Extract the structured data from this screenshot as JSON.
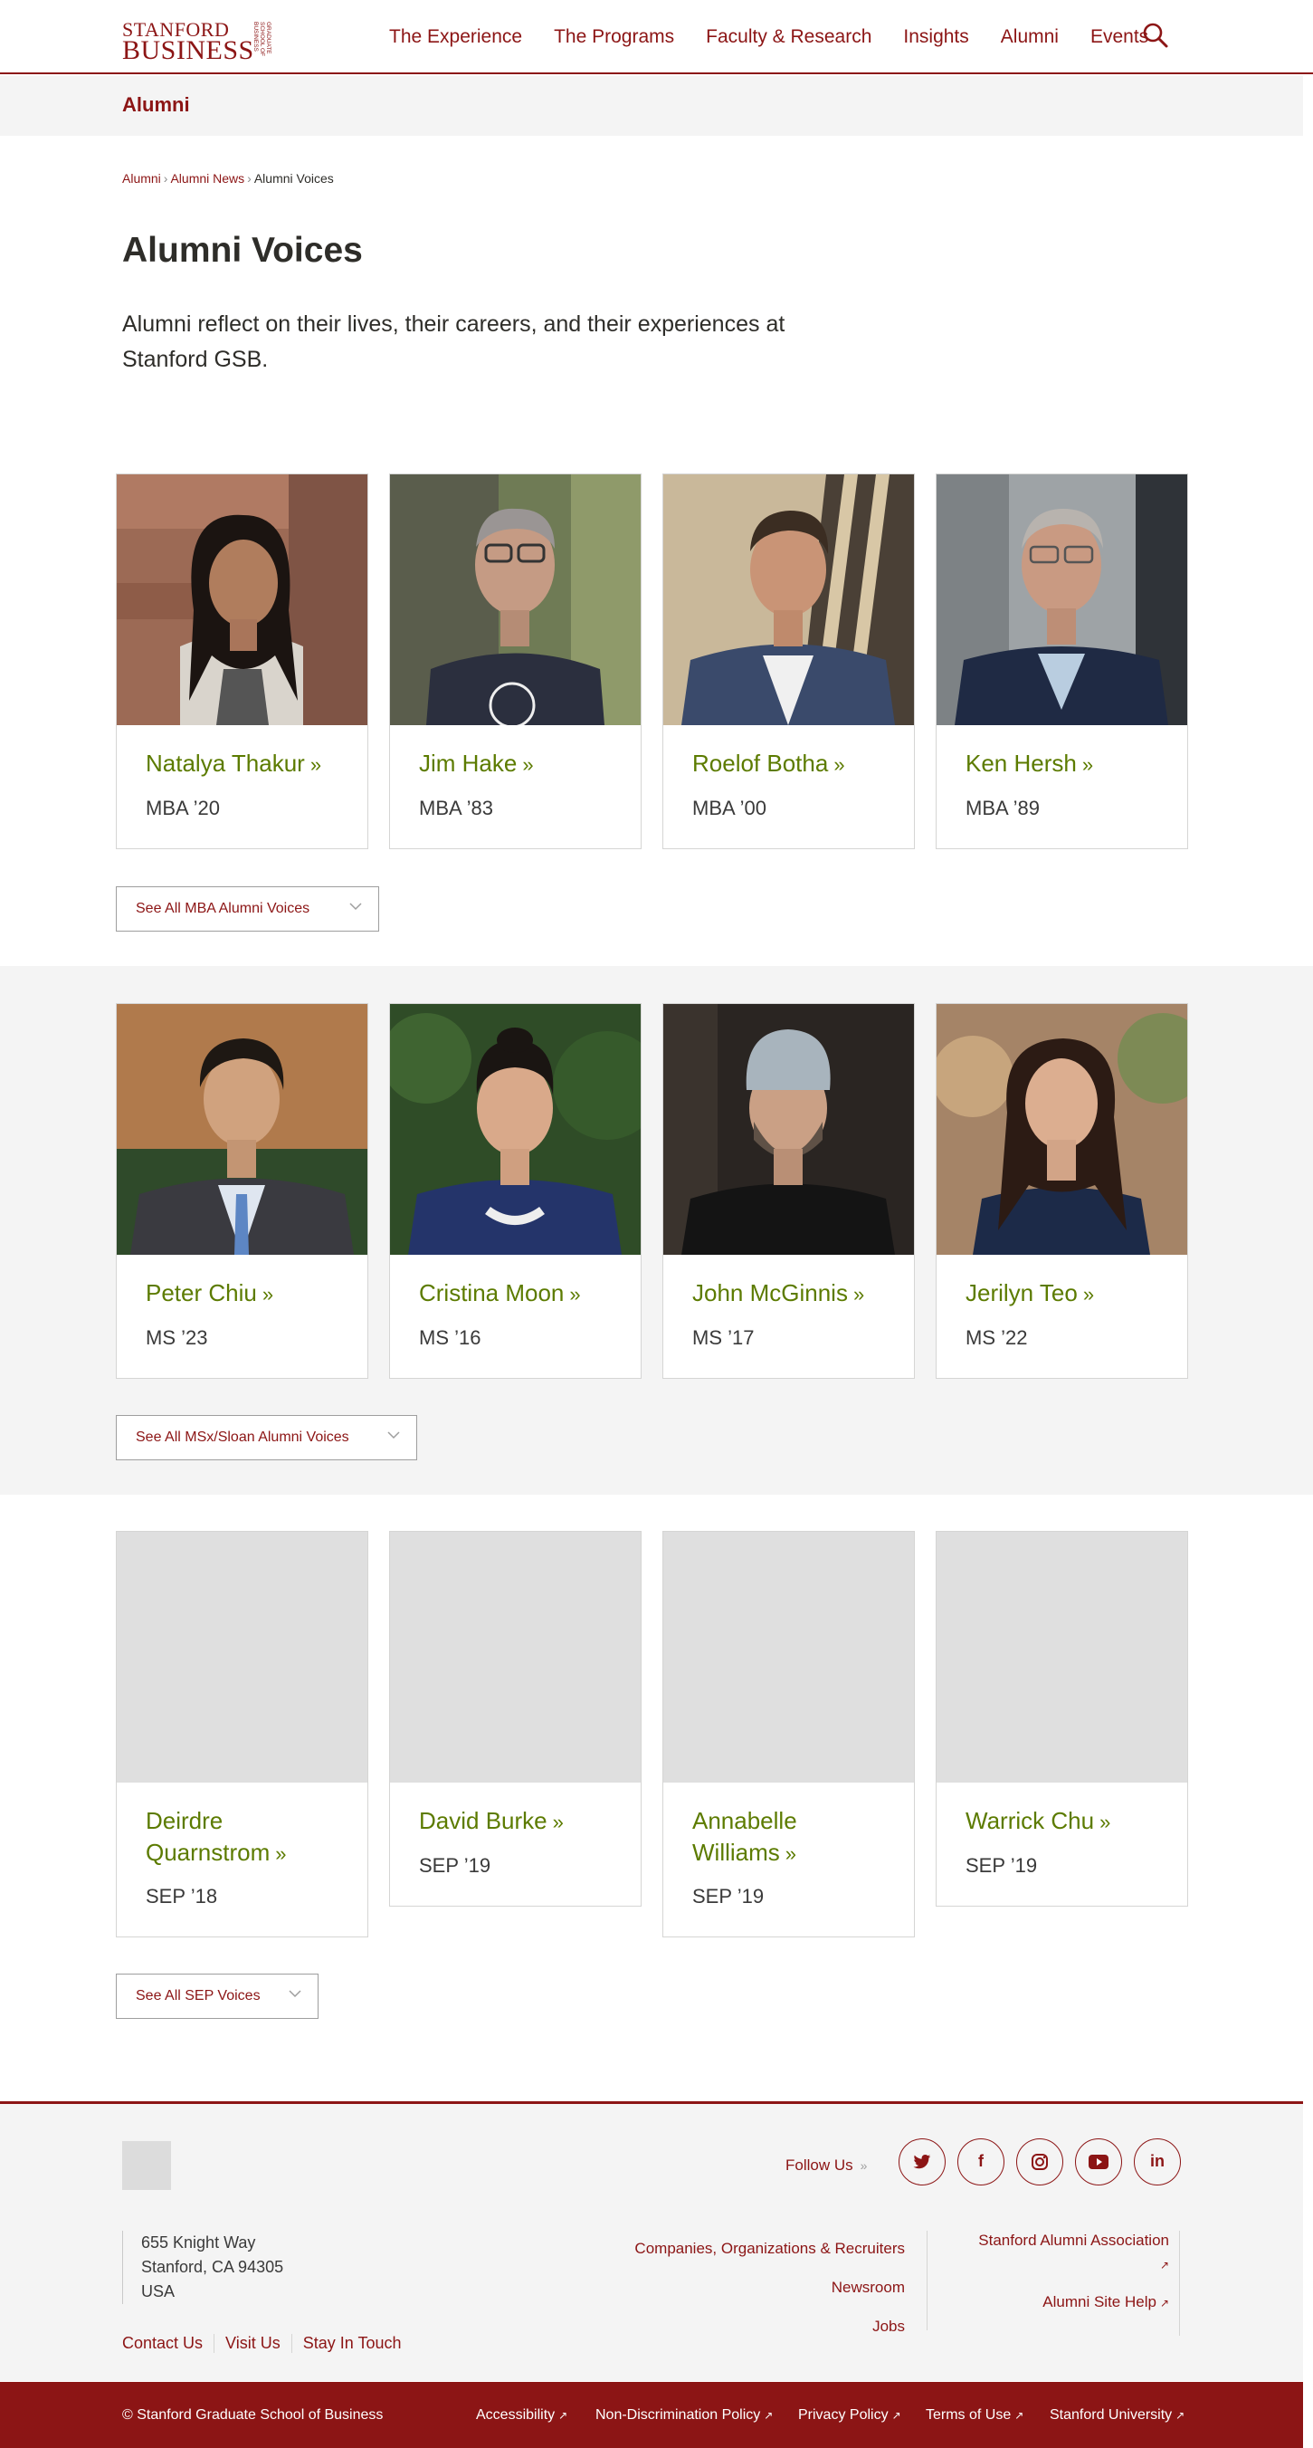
{
  "header": {
    "logo_line1": "STANFORD",
    "logo_line2": "BUSINESS",
    "logo_side": "GRADUATE SCHOOL OF BUSINESS",
    "nav": [
      "The Experience",
      "The Programs",
      "Faculty & Research",
      "Insights",
      "Alumni",
      "Events"
    ],
    "search_icon": "search-icon"
  },
  "section_bar": {
    "label": "Alumni"
  },
  "breadcrumb": [
    "Alumni",
    "Alumni News",
    "Alumni Voices"
  ],
  "page": {
    "title": "Alumni Voices",
    "intro": "Alumni reflect on their lives, their careers, and their experiences at Stanford GSB."
  },
  "mba": {
    "cards": [
      {
        "name": "Natalya Thakur",
        "year": "MBA ’20"
      },
      {
        "name": "Jim Hake",
        "year": "MBA ’83"
      },
      {
        "name": "Roelof Botha",
        "year": "MBA ’00"
      },
      {
        "name": "Ken Hersh",
        "year": "MBA ’89"
      }
    ],
    "see_all": "See All MBA Alumni Voices"
  },
  "msx": {
    "cards": [
      {
        "name": "Peter Chiu",
        "year": "MS ’23"
      },
      {
        "name": "Cristina Moon",
        "year": "MS ’16"
      },
      {
        "name": "John McGinnis",
        "year": "MS ’17"
      },
      {
        "name": "Jerilyn Teo",
        "year": "MS ’22"
      }
    ],
    "see_all": "See All MSx/Sloan Alumni Voices"
  },
  "sep": {
    "cards": [
      {
        "name": "Deirdre Quarnstrom",
        "year": "SEP ’18"
      },
      {
        "name": "David Burke",
        "year": "SEP ’19"
      },
      {
        "name": "Annabelle Williams",
        "year": "SEP ’19"
      },
      {
        "name": "Warrick Chu",
        "year": "SEP ’19"
      }
    ],
    "see_all": "See All SEP Voices"
  },
  "chevron_glyph": "»",
  "footer": {
    "follow_label": "Follow Us",
    "social": [
      "twitter-icon",
      "facebook-icon",
      "instagram-icon",
      "youtube-icon",
      "linkedin-icon"
    ],
    "address": [
      "655 Knight Way",
      "Stanford, CA 94305",
      "USA"
    ],
    "links": [
      "Contact Us",
      "Visit Us",
      "Stay In Touch"
    ],
    "mid_links": [
      "Companies, Organizations & Recruiters",
      "Newsroom",
      "Jobs"
    ],
    "right_links": [
      "Stanford Alumni Association",
      "Alumni Site Help"
    ],
    "copyright": "© Stanford Graduate School of Business",
    "bottom_links": [
      "Accessibility",
      "Non-Discrimination Policy",
      "Privacy Policy",
      "Terms of Use",
      "Stanford University"
    ]
  },
  "colors": {
    "brand": "#8c1515",
    "name_green": "#5c7b00",
    "band_gray": "#f4f4f4"
  }
}
